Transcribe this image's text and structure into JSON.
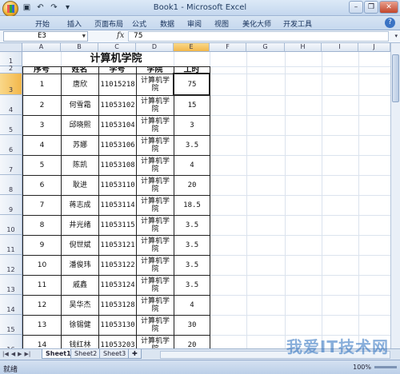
{
  "window": {
    "title": "Book1 - Microsoft Excel"
  },
  "ribbon": {
    "tabs": [
      "开始",
      "插入",
      "页面布局",
      "公式",
      "数据",
      "审阅",
      "视图",
      "美化大师",
      "开发工具"
    ],
    "help": "?"
  },
  "formula_bar": {
    "name_box": "E3",
    "fx": "fx",
    "content": "75"
  },
  "columns": [
    "A",
    "B",
    "C",
    "D",
    "E",
    "F",
    "G",
    "H",
    "I",
    "J"
  ],
  "rows": [
    "1",
    "2",
    "3",
    "4",
    "5",
    "6",
    "7",
    "8",
    "9",
    "10",
    "11",
    "12",
    "13",
    "14",
    "15",
    "16"
  ],
  "sheet": {
    "title": "计算机学院",
    "headers": [
      "序号",
      "姓名",
      "学号",
      "学院",
      "工时"
    ],
    "records": [
      [
        "1",
        "唐欣",
        "11015218",
        "计算机学院",
        "75"
      ],
      [
        "2",
        "何雪霜",
        "11053102",
        "计算机学院",
        "15"
      ],
      [
        "3",
        "邱晓熙",
        "11053104",
        "计算机学院",
        "3"
      ],
      [
        "4",
        "苏娜",
        "11053106",
        "计算机学院",
        "3.5"
      ],
      [
        "5",
        "陈凯",
        "11053108",
        "计算机学院",
        "4"
      ],
      [
        "6",
        "耿进",
        "11053110",
        "计算机学院",
        "20"
      ],
      [
        "7",
        "蒋志成",
        "11053114",
        "计算机学院",
        "18.5"
      ],
      [
        "8",
        "井光绪",
        "11053115",
        "计算机学院",
        "3.5"
      ],
      [
        "9",
        "倪世斌",
        "11053121",
        "计算机学院",
        "3.5"
      ],
      [
        "10",
        "潘俊玮",
        "11053122",
        "计算机学院",
        "3.5"
      ],
      [
        "11",
        "戚鑫",
        "11053124",
        "计算机学院",
        "3.5"
      ],
      [
        "12",
        "吴华杰",
        "11053128",
        "计算机学院",
        "4"
      ],
      [
        "13",
        "徐锡健",
        "11053130",
        "计算机学院",
        "30"
      ],
      [
        "14",
        "钱红林",
        "11053203",
        "计算机学院",
        "20"
      ]
    ]
  },
  "sheet_tabs": [
    "Sheet1",
    "Sheet2",
    "Sheet3"
  ],
  "status": {
    "ready": "就绪",
    "zoom": "100%"
  },
  "watermark": "我爱IT技术网"
}
